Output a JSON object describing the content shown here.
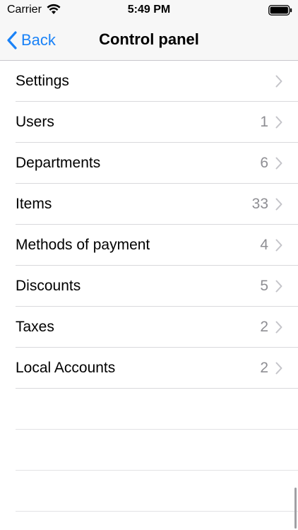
{
  "status_bar": {
    "carrier": "Carrier",
    "time": "5:49 PM"
  },
  "nav": {
    "back_label": "Back",
    "title": "Control panel"
  },
  "colors": {
    "accent": "#1a82f7",
    "count": "#8e8e93",
    "bar_bg": "#f7f7f7"
  },
  "items": [
    {
      "label": "Settings",
      "count": ""
    },
    {
      "label": "Users",
      "count": "1"
    },
    {
      "label": "Departments",
      "count": "6"
    },
    {
      "label": "Items",
      "count": "33"
    },
    {
      "label": "Methods of payment",
      "count": "4"
    },
    {
      "label": "Discounts",
      "count": "5"
    },
    {
      "label": "Taxes",
      "count": "2"
    },
    {
      "label": "Local Accounts",
      "count": "2"
    }
  ]
}
